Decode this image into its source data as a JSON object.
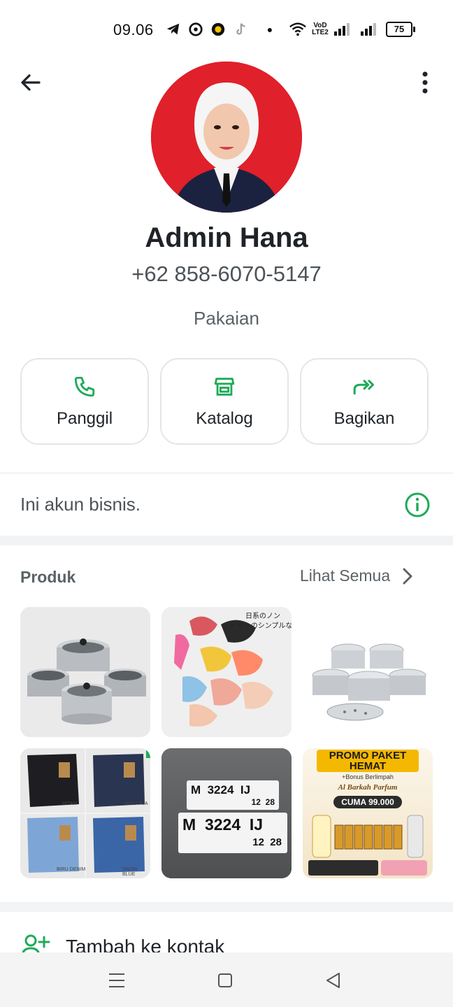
{
  "status_bar": {
    "time": "09.06",
    "icons_left": [
      "telegram-icon",
      "notification-icon",
      "app-icon",
      "tiktok-icon"
    ],
    "volte_label": "VoD LTE2",
    "battery": "75"
  },
  "profile": {
    "name": "Admin Hana",
    "phone": "+62 858-6070-5147",
    "category": "Pakaian"
  },
  "actions": [
    {
      "label": "Panggil",
      "icon": "phone-icon"
    },
    {
      "label": "Katalog",
      "icon": "store-icon"
    },
    {
      "label": "Bagikan",
      "icon": "forward-icon"
    }
  ],
  "business_notice": {
    "text": "Ini akun bisnis."
  },
  "products": {
    "title": "Produk",
    "see_all_label": "Lihat Semua",
    "items": [
      {
        "name": "cookware-set"
      },
      {
        "name": "bra-set",
        "overlay_text": "日系のノン イヤーのシンプルな下"
      },
      {
        "name": "steel-pot-set"
      },
      {
        "name": "jeans-collection",
        "labels": [
          "HITAM",
          "BIRU TUA",
          "BIRU DENIM",
          "SNOW BLUE"
        ]
      },
      {
        "name": "license-plate",
        "plate_top": "M  3224  IJ",
        "plate_bottom": "12  28"
      },
      {
        "name": "perfume-promo",
        "promo": "PROMO PAKET HEMAT",
        "bonus": "+Bonus Berlimpah",
        "brand": "Al Barkah Parfum",
        "price": "CUMA 99.000"
      }
    ]
  },
  "add_contact": {
    "label": "Tambah ke kontak"
  },
  "colors": {
    "accent_green": "#1faa59",
    "avatar_bg": "#e0202a"
  }
}
